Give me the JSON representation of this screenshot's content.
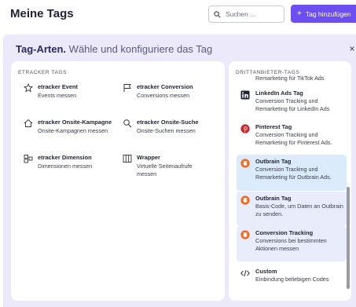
{
  "page": {
    "title": "Meine Tags"
  },
  "search": {
    "placeholder": "Suchen ..."
  },
  "add_button": {
    "label": "Tag hinzufügen",
    "icon": "plus-icon"
  },
  "modal": {
    "title_strong": "Tag-Arten.",
    "title_light": "Wähle und konfiguriere das Tag",
    "close_label": "×"
  },
  "etracker": {
    "heading": "ETRACKER TAGS",
    "items": [
      {
        "name": "etracker Event",
        "desc": "Events messen",
        "icon": "star-icon"
      },
      {
        "name": "etracker Conversion",
        "desc": "Conversions messen",
        "icon": "flag-icon"
      },
      {
        "name": "etracker Onsite-Kampagne",
        "desc": "Onsite-Kampagnen messen",
        "icon": "home-icon"
      },
      {
        "name": "etracker Onsite-Suche",
        "desc": "Onsite-Suchen messen",
        "icon": "search-icon"
      },
      {
        "name": "etracker Dimension",
        "desc": "Dimensionen messen",
        "icon": "dimension-icon"
      },
      {
        "name": "Wrapper",
        "desc": "Virtuelle Seitenaufrufe messen",
        "icon": "columns-icon"
      }
    ]
  },
  "third_party": {
    "heading": "DRITTANBIETER-TAGS",
    "clipped_text": "Remarketing für TikTok Ads",
    "items": [
      {
        "name": "LinkedIn Ads Tag",
        "desc": "Conversion Tracking und Remarketing für LinkedIn Ads",
        "icon": "linkedin-icon"
      },
      {
        "name": "Pinterest Tag",
        "desc": "Conversion Tracking und Remarketing für Pinterest Ads.",
        "icon": "pinterest-icon"
      },
      {
        "name": "Outbrain Tag",
        "desc": "Conversion Tracking und Remarketing für Outbrain Ads.",
        "icon": "outbrain-icon"
      },
      {
        "name": "Outbrain Tag",
        "desc": "Basis-Code, um Daten an Outbrain zu senden.",
        "icon": "outbrain-icon"
      },
      {
        "name": "Conversion Tracking",
        "desc": "Conversions bei bestimmten Aktionen messen",
        "icon": "outbrain-icon"
      },
      {
        "name": "Custom",
        "desc": "Einbindung beliebigen Codes",
        "icon": "code-icon"
      }
    ]
  },
  "colors": {
    "accent": "#6d4ff0",
    "modal_bg": "#ece9fb",
    "outbrain": "#f26a22",
    "pinterest": "#d6202b"
  }
}
